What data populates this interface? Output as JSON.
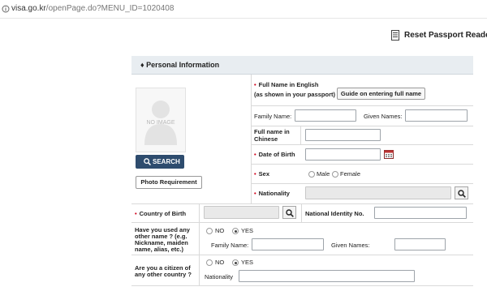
{
  "browser": {
    "url_host": "visa.go.kr",
    "url_path": "/openPage.do?MENU_ID=1020408"
  },
  "header": {
    "reset_label": "Reset Passport Reader"
  },
  "section": {
    "title": "Personal Information"
  },
  "photo": {
    "placeholder": "NO IMAGE",
    "search_label": "SEARCH",
    "requirement_label": "Photo Requirement"
  },
  "full_name": {
    "label_line1": "Full Name in English",
    "label_line2": "(as shown in your passport)",
    "guide_button": "Guide on entering full name",
    "family_label": "Family Name:",
    "given_label": "Given Names:",
    "family_value": "",
    "given_value": ""
  },
  "chinese_name": {
    "label_line1": "Full name in",
    "label_line2": "Chinese",
    "value": ""
  },
  "dob": {
    "label": "Date of Birth",
    "value": ""
  },
  "sex": {
    "label": "Sex",
    "options": [
      "Male",
      "Female"
    ],
    "selected": ""
  },
  "nationality": {
    "label": "Nationality",
    "value": ""
  },
  "country_of_birth": {
    "label": "Country of Birth",
    "value": ""
  },
  "national_id": {
    "label": "National Identity No.",
    "value": ""
  },
  "other_name": {
    "label_lines": [
      "Have you used any",
      "other name ? (e.g.",
      "Nickname, maiden",
      "name, alias, etc.)"
    ],
    "options": [
      "NO",
      "YES"
    ],
    "selected": "YES",
    "family_label": "Family Name:",
    "given_label": "Given Names:"
  },
  "other_citizen": {
    "label_lines": [
      "Are you a citizen of",
      "any other country ?"
    ],
    "options": [
      "NO",
      "YES"
    ],
    "selected": "YES",
    "nationality_label": "Nationality"
  }
}
